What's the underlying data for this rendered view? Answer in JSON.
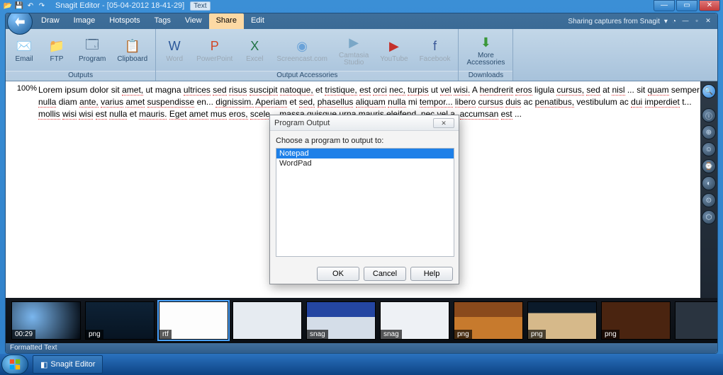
{
  "window": {
    "title_prefix": "Snagit Editor - ",
    "document_name": "[05-04-2012 18-41-29]",
    "badge": "Text"
  },
  "window_controls": {
    "min": "—",
    "max": "▭",
    "close": "✕"
  },
  "menu": {
    "items": [
      "Draw",
      "Image",
      "Hotspots",
      "Tags",
      "View",
      "Share",
      "Edit"
    ],
    "active_index": 5,
    "help_text": "Sharing captures from Snagit",
    "help_dd": "▾",
    "mini": {
      "min": "—",
      "restore": "▫",
      "close": "✕"
    }
  },
  "ribbon": {
    "groups": [
      {
        "label": "Outputs",
        "buttons": [
          {
            "name": "email",
            "label": "Email",
            "icon": "✉️"
          },
          {
            "name": "ftp",
            "label": "FTP",
            "icon": "📁"
          },
          {
            "name": "program",
            "label": "Program",
            "icon": "🗔"
          },
          {
            "name": "clipboard",
            "label": "Clipboard",
            "icon": "📋"
          }
        ]
      },
      {
        "label": "Output Accessories",
        "buttons": [
          {
            "name": "word",
            "label": "Word",
            "icon": "W",
            "disabled": true,
            "color": "#2b579a"
          },
          {
            "name": "powerpoint",
            "label": "PowerPoint",
            "icon": "P",
            "disabled": true,
            "color": "#d24726"
          },
          {
            "name": "excel",
            "label": "Excel",
            "icon": "X",
            "disabled": true,
            "color": "#217346"
          },
          {
            "name": "screencast",
            "label": "Screencast.com",
            "icon": "◉",
            "disabled": true,
            "color": "#6aa2d8"
          },
          {
            "name": "camtasia",
            "label": "Camtasia\nStudio",
            "icon": "▶",
            "disabled": true,
            "color": "#7aa7c7"
          },
          {
            "name": "youtube",
            "label": "YouTube",
            "icon": "▶",
            "disabled": true,
            "color": "#c4302b"
          },
          {
            "name": "facebook",
            "label": "Facebook",
            "icon": "f",
            "disabled": true,
            "color": "#3b5998"
          }
        ]
      },
      {
        "label": "Downloads",
        "buttons": [
          {
            "name": "more-accessories",
            "label": "More\nAccessories",
            "icon": "⬇",
            "color": "#3a973a"
          }
        ]
      }
    ]
  },
  "zoom": "100%",
  "document_text": "Lorem ipsum dolor sit amet, ut magna ultrices sed risus suscipit natoque, et tristique, est orci nec, turpis ut vel wisi. A hendrerit eros ligula cursus, sed at nisl ... sit quam semper nulla diam ante, varius amet suspendisse en... dignissim. Aperiam et sed, phasellus aliquam nulla mi tempor... libero cursus duis ac penatibus, vestibulum ac dui imperdiet t... mollis wisi wisi est nulla et mauris. Eget amet mus eros, scele... massa quisque urna mauris eleifend, nec vel a, accumsan est ...",
  "dialog": {
    "title": "Program Output",
    "prompt": "Choose a program to output to:",
    "items": [
      "Notepad",
      "WordPad"
    ],
    "selected_index": 0,
    "buttons": {
      "ok": "OK",
      "cancel": "Cancel",
      "help": "Help"
    },
    "close": "✕"
  },
  "tray": {
    "thumbs": [
      {
        "label": "00:29",
        "cls": "t1"
      },
      {
        "label": "png",
        "cls": "t2"
      },
      {
        "label": "rtf",
        "cls": "t3",
        "selected": true
      },
      {
        "label": "",
        "cls": "t4"
      },
      {
        "label": "snag",
        "cls": "t5"
      },
      {
        "label": "snag",
        "cls": "t6"
      },
      {
        "label": "png",
        "cls": "t7"
      },
      {
        "label": "png",
        "cls": "t8"
      },
      {
        "label": "png",
        "cls": "t9"
      },
      {
        "label": "",
        "cls": "t10"
      }
    ]
  },
  "status": "Formatted Text",
  "side_tools": [
    "🔍",
    "",
    "ⓘ",
    "⊕",
    "☺",
    "⌚",
    "◐",
    "⊙",
    "⬡"
  ],
  "taskbar": {
    "app": "Snagit Editor"
  }
}
